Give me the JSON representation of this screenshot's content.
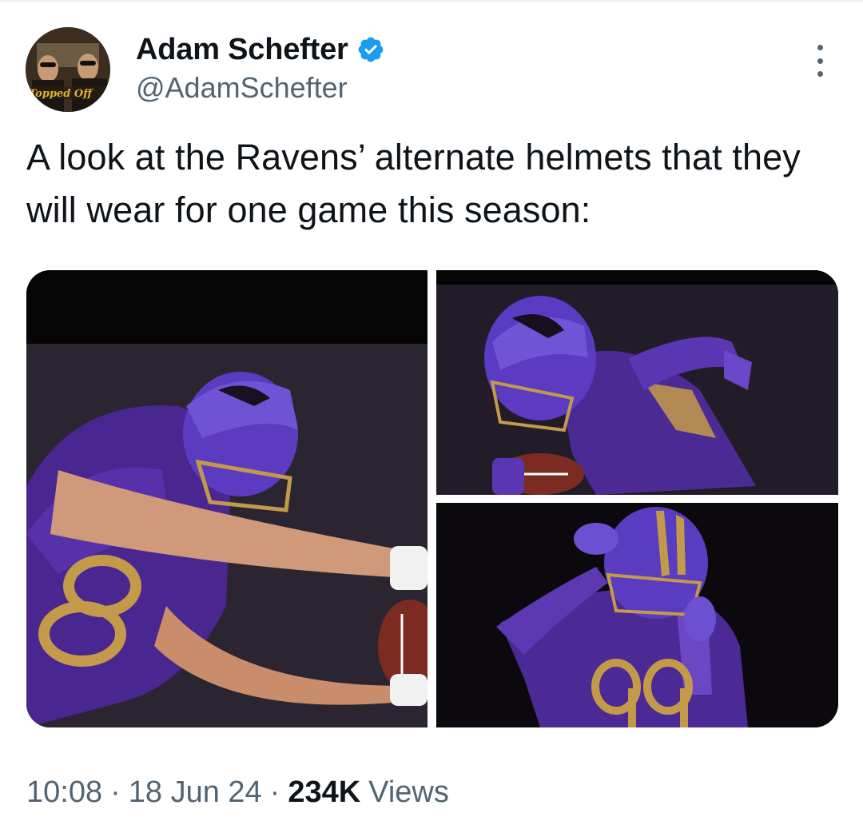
{
  "tweet": {
    "author": {
      "display_name": "Adam Schefter",
      "handle": "@AdamSchefter",
      "verified": true,
      "avatar_caption": "Topped Off"
    },
    "text": "A look at the Ravens’ alternate helmets that they will wear for one game this season:",
    "media": [
      {
        "description": "player-8-reaching-with-football"
      },
      {
        "description": "player-16-running-with-football"
      },
      {
        "description": "player-99-hands-on-helmet"
      }
    ],
    "meta": {
      "time": "10:08",
      "separator": "·",
      "date": "18 Jun 24",
      "views_count": "234K",
      "views_label": "Views"
    }
  },
  "colors": {
    "text_primary": "#0f1419",
    "text_secondary": "#536471",
    "verified_blue": "#1d9bf0",
    "ravens_purple": "#5b2aa8",
    "ravens_gold": "#c39a4a"
  },
  "icons": {
    "verified": "verified-badge-icon",
    "more": "more-dots-icon"
  }
}
